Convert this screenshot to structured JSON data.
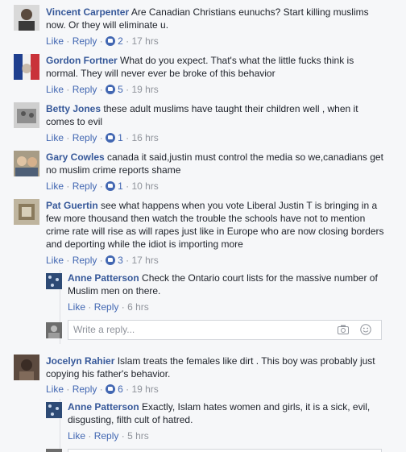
{
  "comments": [
    {
      "author": "Vincent Carpenter",
      "text": "Are Canadian Christians eunuchs? Start killing muslims now. Or they will eliminate u.",
      "like": "Like",
      "reply": "Reply",
      "likes": "2",
      "time": "17 hrs",
      "avatar_color": "#6b6b6b"
    },
    {
      "author": "Gordon Fortner",
      "text": "What do you expect. That's what the little fucks think is normal. They will never ever be broke of this behavior",
      "like": "Like",
      "reply": "Reply",
      "likes": "5",
      "time": "19 hrs",
      "avatar_color": "#c9323a"
    },
    {
      "author": "Betty Jones",
      "text": "these adult muslims have taught their children well , when it comes to evil",
      "like": "Like",
      "reply": "Reply",
      "likes": "1",
      "time": "16 hrs",
      "avatar_color": "#8a8a8a"
    },
    {
      "author": "Gary Cowles",
      "text": "canada it said,justin must control the media so we,canadians get no muslim crime reports shame",
      "like": "Like",
      "reply": "Reply",
      "likes": "1",
      "time": "10 hrs",
      "avatar_color": "#8c7a5e"
    },
    {
      "author": "Pat Guertin",
      "text": "see what happens when you vote Liberal Justin T is bringing in a few more thousand then watch the trouble the schools have not to mention crime rate will rise as will rapes just like in Europe who are now closing borders and deporting while the idiot is importing more",
      "like": "Like",
      "reply": "Reply",
      "likes": "3",
      "time": "17 hrs",
      "avatar_color": "#9a8e74"
    },
    {
      "author": "Jocelyn Rahier",
      "text": "Islam treats the females like dirt . This boy was probably just copying his father's behavior.",
      "like": "Like",
      "reply": "Reply",
      "likes": "6",
      "time": "19 hrs",
      "avatar_color": "#4a3a32"
    }
  ],
  "replies": [
    {
      "author": "Anne Patterson",
      "text": "Check the Ontario court lists for the massive number of Muslim men on there.",
      "like": "Like",
      "reply": "Reply",
      "time": "6 hrs",
      "avatar_color": "#2d4a75"
    },
    {
      "author": "Anne Patterson",
      "text": "Exactly, Islam hates women and girls, it is a sick, evil, disgusting, filth cult of hatred.",
      "like": "Like",
      "reply": "Reply",
      "time": "5 hrs",
      "avatar_color": "#2d4a75"
    }
  ],
  "reply_box": {
    "placeholder": "Write a reply...",
    "camera_icon": "camera-icon",
    "emoji_icon": "emoji-icon"
  },
  "colors": {
    "link": "#4267b2",
    "author": "#365899",
    "meta": "#90949c",
    "background": "#f6f7f9"
  }
}
